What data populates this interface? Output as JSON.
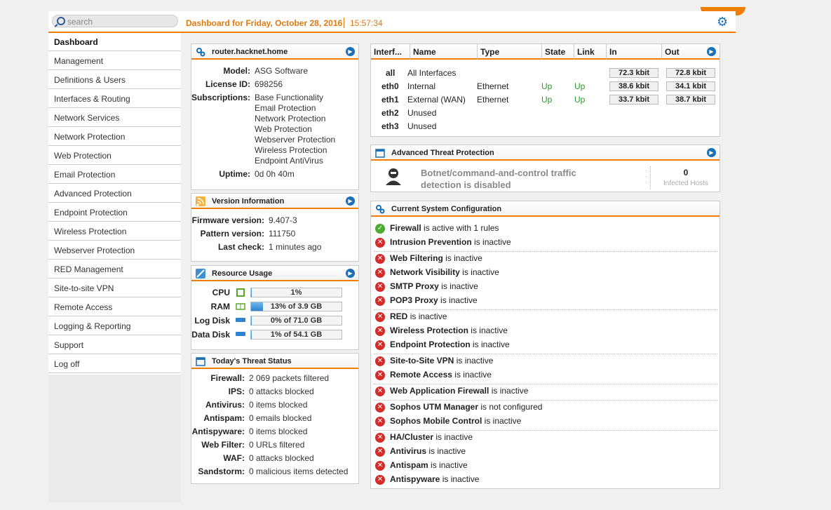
{
  "header": {
    "search_placeholder": "search",
    "dashboard_title": "Dashboard for Friday, October 28, 2016",
    "time": "15:57:34",
    "accent": "#f07c00"
  },
  "sidebar": {
    "items": [
      "Dashboard",
      "Management",
      "Definitions & Users",
      "Interfaces & Routing",
      "Network Services",
      "Network Protection",
      "Web Protection",
      "Email Protection",
      "Advanced Protection",
      "Endpoint Protection",
      "Wireless Protection",
      "Webserver Protection",
      "RED Management",
      "Site-to-site VPN",
      "Remote Access",
      "Logging & Reporting",
      "Support",
      "Log off"
    ]
  },
  "device": {
    "title": "router.hacknet.home",
    "model_label": "Model:",
    "model": "ASG Software",
    "license_label": "License ID:",
    "license": "698256",
    "subs_label": "Subscriptions:",
    "subscriptions": [
      "Base Functionality",
      "Email Protection",
      "Network Protection",
      "Web Protection",
      "Webserver Protection",
      "Wireless Protection",
      "Endpoint AntiVirus"
    ],
    "uptime_label": "Uptime:",
    "uptime": "0d 0h 40m"
  },
  "version": {
    "title": "Version Information",
    "rows": [
      {
        "label": "Firmware version:",
        "value": "9.407-3"
      },
      {
        "label": "Pattern version:",
        "value": "111750"
      },
      {
        "label": "Last check:",
        "value": "1 minutes ago"
      }
    ]
  },
  "resources": {
    "title": "Resource Usage",
    "rows": [
      {
        "label": "CPU",
        "text": "1%",
        "fraction": 0.01
      },
      {
        "label": "RAM",
        "text": "13% of 3.9 GB",
        "fraction": 0.13
      },
      {
        "label": "Log Disk",
        "text": "0% of 71.0 GB",
        "fraction": 0.0
      },
      {
        "label": "Data Disk",
        "text": "1% of 54.1 GB",
        "fraction": 0.01
      }
    ]
  },
  "threats": {
    "title": "Today's Threat Status",
    "rows": [
      {
        "label": "Firewall:",
        "value": "2 069 packets filtered"
      },
      {
        "label": "IPS:",
        "value": "0 attacks blocked"
      },
      {
        "label": "Antivirus:",
        "value": "0 items blocked"
      },
      {
        "label": "Antispam:",
        "value": "0 emails blocked"
      },
      {
        "label": "Antispyware:",
        "value": "0 items blocked"
      },
      {
        "label": "Web Filter:",
        "value": "0 URLs filtered"
      },
      {
        "label": "WAF:",
        "value": "0 attacks blocked"
      },
      {
        "label": "Sandstorm:",
        "value": "0 malicious items detected"
      }
    ]
  },
  "interfaces": {
    "headers": [
      "Interf...",
      "Name",
      "Type",
      "State",
      "Link",
      "In",
      "Out"
    ],
    "rows": [
      {
        "iface": "all",
        "name": "All Interfaces",
        "type": "",
        "state": "",
        "link": "",
        "in": "72.3 kbit",
        "out": "72.8 kbit"
      },
      {
        "iface": "eth0",
        "name": "Internal",
        "type": "Ethernet",
        "state": "Up",
        "link": "Up",
        "in": "38.6 kbit",
        "out": "34.1 kbit"
      },
      {
        "iface": "eth1",
        "name": "External (WAN)",
        "type": "Ethernet",
        "state": "Up",
        "link": "Up",
        "in": "33.7 kbit",
        "out": "38.7 kbit"
      },
      {
        "iface": "eth2",
        "name": "Unused",
        "type": "",
        "state": "",
        "link": "",
        "in": "",
        "out": ""
      },
      {
        "iface": "eth3",
        "name": "Unused",
        "type": "",
        "state": "",
        "link": "",
        "in": "",
        "out": ""
      }
    ]
  },
  "atp": {
    "title": "Advanced Threat Protection",
    "message_line1": "Botnet/command-and-control traffic",
    "message_line2": "detection is disabled",
    "count": "0",
    "count_label": "Infected Hosts"
  },
  "config": {
    "title": "Current System Configuration",
    "rows": [
      {
        "name": "Firewall",
        "status": "is active with 1 rules",
        "ok": true
      },
      {
        "name": "Intrusion Prevention",
        "status": "is inactive",
        "ok": false
      },
      {
        "name": "Web Filtering",
        "status": "is inactive",
        "ok": false
      },
      {
        "name": "Network Visibility",
        "status": "is inactive",
        "ok": false
      },
      {
        "name": "SMTP Proxy",
        "status": "is inactive",
        "ok": false
      },
      {
        "name": "POP3 Proxy",
        "status": "is inactive",
        "ok": false
      },
      {
        "name": "RED",
        "status": "is inactive",
        "ok": false
      },
      {
        "name": "Wireless Protection",
        "status": "is inactive",
        "ok": false
      },
      {
        "name": "Endpoint Protection",
        "status": "is inactive",
        "ok": false
      },
      {
        "name": "Site-to-Site VPN",
        "status": "is inactive",
        "ok": false
      },
      {
        "name": "Remote Access",
        "status": "is inactive",
        "ok": false
      },
      {
        "name": "Web Application Firewall",
        "status": "is inactive",
        "ok": false
      },
      {
        "name": "Sophos UTM Manager",
        "status": "is not configured",
        "ok": false
      },
      {
        "name": "Sophos Mobile Control",
        "status": "is inactive",
        "ok": false
      },
      {
        "name": "HA/Cluster",
        "status": "is inactive",
        "ok": false
      },
      {
        "name": "Antivirus",
        "status": "is inactive",
        "ok": false
      },
      {
        "name": "Antispam",
        "status": "is inactive",
        "ok": false
      },
      {
        "name": "Antispyware",
        "status": "is inactive",
        "ok": false
      }
    ]
  }
}
